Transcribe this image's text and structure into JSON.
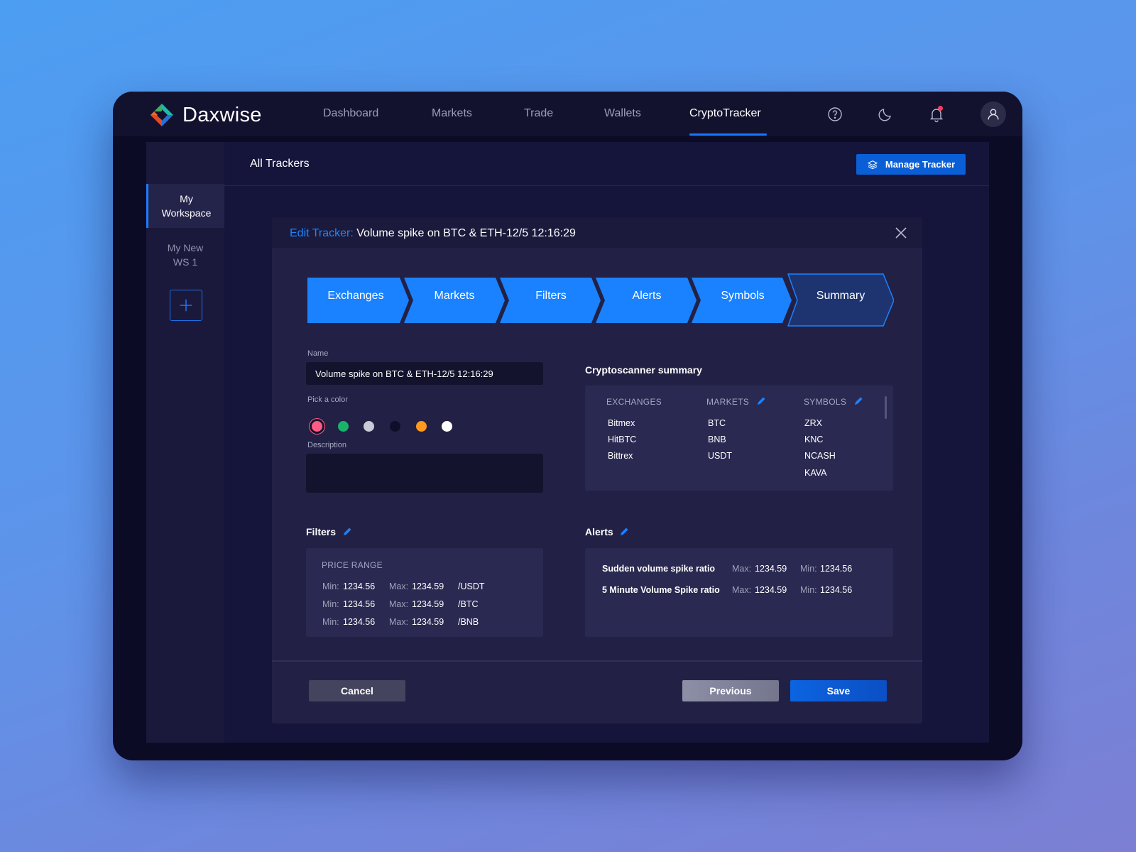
{
  "app": {
    "name": "Daxwise",
    "nav": [
      "Dashboard",
      "Markets",
      "Trade",
      "Wallets",
      "CryptoTracker"
    ],
    "active_nav": "CryptoTracker"
  },
  "sidebar": {
    "items": [
      {
        "line1": "My",
        "line2": "Workspace",
        "active": true
      },
      {
        "line1": "My New",
        "line2": "WS 1",
        "active": false
      }
    ]
  },
  "main": {
    "title": "All Trackers",
    "manage_label": "Manage Tracker"
  },
  "modal": {
    "title_prefix": "Edit Tracker:",
    "title": "Volume spike on BTC & ETH-12/5 12:16:29",
    "steps": [
      "Exchanges",
      "Markets",
      "Filters",
      "Alerts",
      "Symbols",
      "Summary"
    ],
    "active_step": "Summary",
    "form": {
      "name_label": "Name",
      "name_value": "Volume spike on BTC & ETH-12/5 12:16:29",
      "color_label": "Pick a color",
      "colors": [
        "#ff5b85",
        "#19b36b",
        "#c9cbd8",
        "#0f0e2a",
        "#ff9a1f",
        "#ffffff"
      ],
      "selected_color": "#ff5b85",
      "description_label": "Description",
      "description_value": ""
    },
    "summary": {
      "title": "Cryptoscanner summary",
      "columns": [
        "EXCHANGES",
        "MARKETS",
        "SYMBOLS"
      ],
      "exchanges": [
        "Bitmex",
        "HitBTC",
        "Bittrex"
      ],
      "markets": [
        "BTC",
        "BNB",
        "USDT"
      ],
      "symbols": [
        "ZRX",
        "KNC",
        "NCASH",
        "KAVA"
      ]
    },
    "filters": {
      "title": "Filters",
      "heading": "PRICE RANGE",
      "min_label": "Min:",
      "max_label": "Max:",
      "rows": [
        {
          "min": "1234.56",
          "max": "1234.59",
          "pair": "/USDT"
        },
        {
          "min": "1234.56",
          "max": "1234.59",
          "pair": "/BTC"
        },
        {
          "min": "1234.56",
          "max": "1234.59",
          "pair": "/BNB"
        }
      ]
    },
    "alerts": {
      "title": "Alerts",
      "max_label": "Max:",
      "min_label": "Min:",
      "rows": [
        {
          "name": "Sudden volume spike ratio",
          "max": "1234.59",
          "min": "1234.56"
        },
        {
          "name": "5 Minute Volume Spike ratio",
          "max": "1234.59",
          "min": "1234.56"
        }
      ]
    },
    "buttons": {
      "cancel": "Cancel",
      "previous": "Previous",
      "save": "Save"
    }
  },
  "colors": {
    "accent": "#1479ff",
    "step_active": "#1a82ff",
    "step_current": "#1e3470"
  }
}
